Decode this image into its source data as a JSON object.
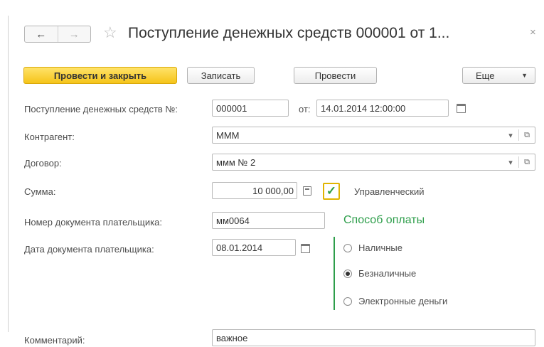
{
  "toolbar": {
    "back_icon": "←",
    "forward_icon": "→",
    "star_icon": "☆",
    "title": "Поступление денежных средств 000001 от 1...",
    "close_icon": "×"
  },
  "actions": {
    "post_close": "Провести и закрыть",
    "save": "Записать",
    "post": "Провести",
    "more": "Еще",
    "more_caret": "▼"
  },
  "form": {
    "doc_number_label": "Поступление денежных средств №:",
    "doc_number_value": "000001",
    "date_prefix": "от:",
    "date_value": "14.01.2014 12:00:00",
    "counterparty_label": "Контрагент:",
    "counterparty_value": "МММ",
    "contract_label": "Договор:",
    "contract_value": "ммм № 2",
    "amount_label": "Сумма:",
    "amount_value": "10 000,00",
    "managerial_checked": true,
    "managerial_label": "Управленческий",
    "payer_doc_number_label": "Номер документа плательщика:",
    "payer_doc_number_value": "мм0064",
    "payer_doc_date_label": "Дата документа плательщика:",
    "payer_doc_date_value": "08.01.2014",
    "comment_label": "Комментарий:",
    "comment_value": "важное"
  },
  "payment": {
    "title": "Способ оплаты",
    "options": [
      {
        "label": "Наличные",
        "selected": false
      },
      {
        "label": "Безналичные",
        "selected": true
      },
      {
        "label": "Электронные деньги",
        "selected": false
      }
    ]
  },
  "icons": {
    "dropdown": "▾",
    "open": "⧉",
    "check": "✓"
  },
  "colors": {
    "primary_button": "#f5c419",
    "accent_green": "#2e9e4b",
    "checkbox_border": "#e0b400"
  }
}
